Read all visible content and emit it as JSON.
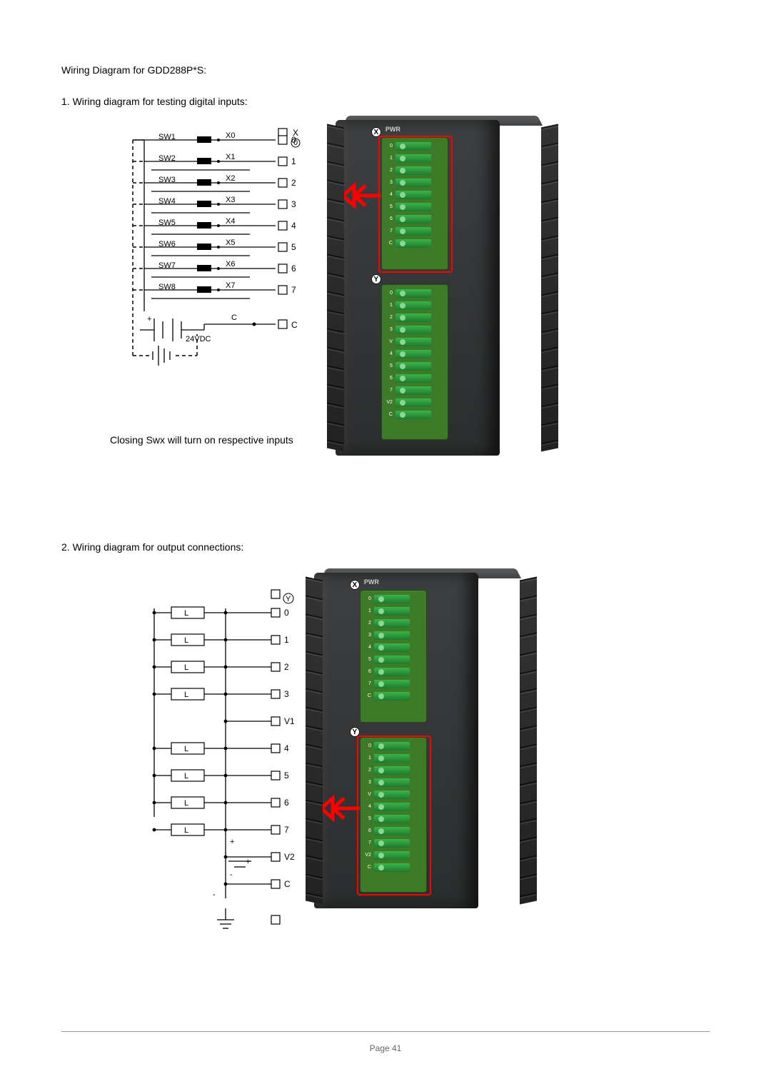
{
  "title": "Wiring Diagram for GDD288P*S:",
  "section1": "1. Wiring diagram for testing digital inputs:",
  "section2": "2. Wiring diagram for output connections:",
  "caption1": "Closing Swx will turn on respective inputs",
  "page_label": "Page 41",
  "module": {
    "pwr_label": "PWR",
    "marker_top": "X",
    "marker_bot": "Y",
    "top_terminals": [
      "0",
      "1",
      "2",
      "3",
      "4",
      "5",
      "6",
      "7",
      "C"
    ],
    "bot_terminals": [
      "0",
      "1",
      "2",
      "3",
      "V",
      "4",
      "5",
      "6",
      "7",
      "V2",
      "C"
    ]
  },
  "input_diagram": {
    "header_top": "X",
    "header_bottom": "0",
    "switches": [
      {
        "sw": "SW1",
        "x": "X0",
        "t": "0"
      },
      {
        "sw": "SW2",
        "x": "X1",
        "t": "1"
      },
      {
        "sw": "SW3",
        "x": "X2",
        "t": "2"
      },
      {
        "sw": "SW4",
        "x": "X3",
        "t": "3"
      },
      {
        "sw": "SW5",
        "x": "X4",
        "t": "4"
      },
      {
        "sw": "SW6",
        "x": "X5",
        "t": "5"
      },
      {
        "sw": "SW7",
        "x": "X6",
        "t": "6"
      },
      {
        "sw": "SW8",
        "x": "X7",
        "t": "7"
      }
    ],
    "common_label": "C",
    "common_terminal": "C",
    "power_label": "24VDC",
    "pos": "+",
    "neg": "-"
  },
  "output_diagram": {
    "header": "Y",
    "loads_top": [
      "L",
      "L",
      "L",
      "L"
    ],
    "loads_bot": [
      "L",
      "L",
      "L",
      "L"
    ],
    "terminals": [
      "0",
      "1",
      "2",
      "3",
      "V1",
      "4",
      "5",
      "6",
      "7",
      "V2",
      "C"
    ],
    "pos": "+",
    "neg": "-"
  }
}
